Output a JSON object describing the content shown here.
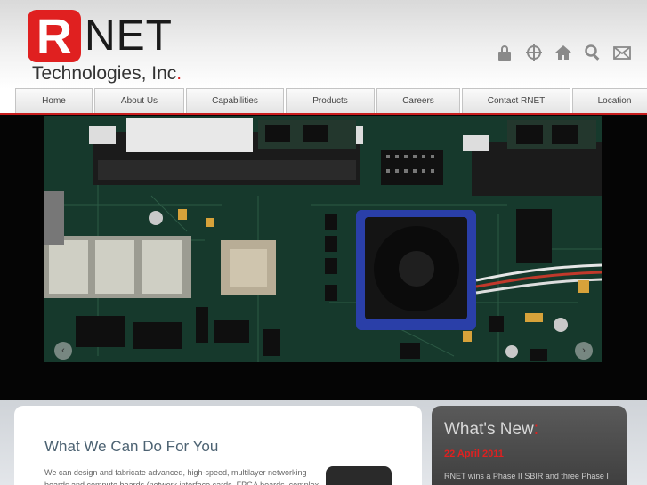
{
  "logo": {
    "letter": "R",
    "name": "NET",
    "subtitle": "Technologies, Inc",
    "subtitle_dot": ".",
    "brand_color": "#e02020"
  },
  "utility_icons": [
    "lock-icon",
    "target-icon",
    "home-icon",
    "search-icon",
    "mail-icon"
  ],
  "nav": {
    "items": [
      {
        "label": "Home"
      },
      {
        "label": "About Us"
      },
      {
        "label": "Capabilities"
      },
      {
        "label": "Products"
      },
      {
        "label": "Careers"
      },
      {
        "label": "Contact RNET"
      },
      {
        "label": "Location"
      }
    ],
    "accent": "#c81e1e"
  },
  "banner": {
    "image": "circuit-board-photo",
    "prev_arrow": "‹",
    "next_arrow": "›"
  },
  "main": {
    "heading": "What We Can Do For You",
    "body": "We can design and fabricate advanced, high-speed, multilayer networking boards and compute boards (network interface cards, FPGA boards, complex"
  },
  "news": {
    "heading": "What's New",
    "heading_dot": ":",
    "date": "22 April 2011",
    "text": "RNET wins a Phase II SBIR and three Phase I SBIR"
  }
}
